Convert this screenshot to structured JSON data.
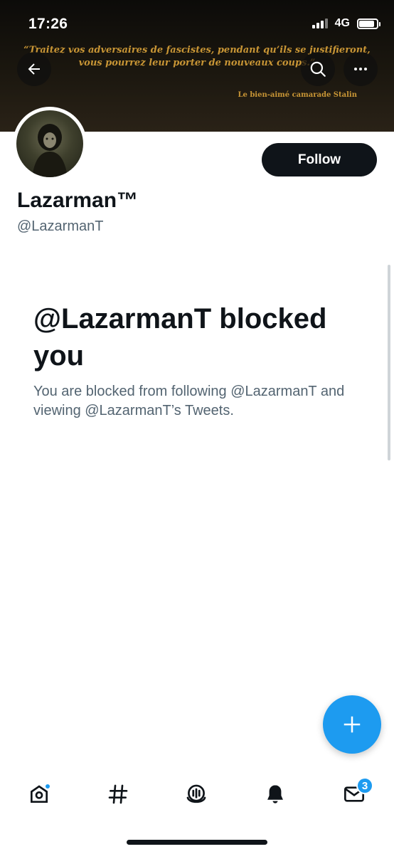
{
  "status_bar": {
    "time": "17:26",
    "network": "4G"
  },
  "banner": {
    "quote_line1": "“Traitez vos adversaires de fascistes, pendant qu’ils se justifieront,",
    "quote_line2": "vous pourrez leur porter de nouveaux coups.”",
    "attribution": "Le bien-aimé camarade Stalin",
    "text_color": "#c89535"
  },
  "header": {
    "back_icon": "arrow-left-icon",
    "search_icon": "search-icon",
    "more_icon": "more-horizontal-icon"
  },
  "profile": {
    "display_name": "Lazarman™",
    "handle": "@LazarmanT",
    "follow_label": "Follow"
  },
  "blocked": {
    "title": "@LazarmanT blocked you",
    "description": "You are blocked from following @LazarmanT and viewing @LazarmanT’s Tweets."
  },
  "fab": {
    "icon": "plus-icon"
  },
  "bottom_nav": {
    "items": [
      {
        "name": "home",
        "icon": "home-icon"
      },
      {
        "name": "explore",
        "icon": "hashtag-icon"
      },
      {
        "name": "spaces",
        "icon": "spaces-icon"
      },
      {
        "name": "notifications",
        "icon": "bell-icon"
      },
      {
        "name": "messages",
        "icon": "envelope-icon"
      }
    ],
    "messages_badge": "3"
  },
  "colors": {
    "accent": "#1d9bf0",
    "text_primary": "#0f1419",
    "text_secondary": "#536471"
  }
}
